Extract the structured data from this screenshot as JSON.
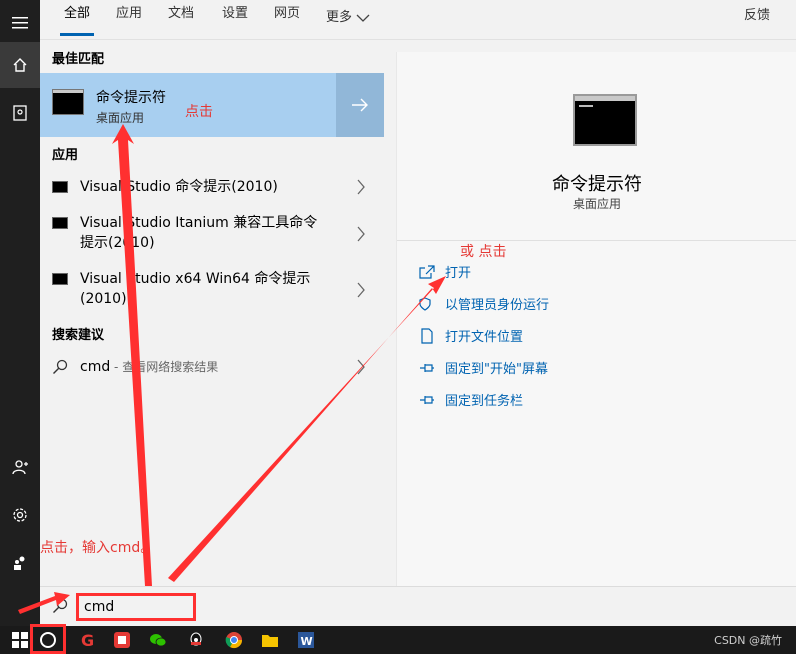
{
  "tabs": [
    {
      "label": "全部"
    },
    {
      "label": "应用"
    },
    {
      "label": "文档"
    },
    {
      "label": "设置"
    },
    {
      "label": "网页"
    },
    {
      "label": "更多"
    }
  ],
  "feedback_label": "反馈",
  "sections": {
    "best_match": "最佳匹配",
    "apps": "应用",
    "suggestions": "搜索建议"
  },
  "best_match": {
    "title": "命令提示符",
    "subtitle": "桌面应用"
  },
  "apps": [
    {
      "label": "Visual Studio 命令提示(2010)"
    },
    {
      "label": "Visual Studio Itanium 兼容工具命令提示(2010)"
    },
    {
      "label": "Visual Studio x64 Win64 命令提示(2010)"
    }
  ],
  "suggestion": {
    "term": "cmd",
    "hint": " - 查看网络搜索结果"
  },
  "detail": {
    "title": "命令提示符",
    "subtitle": "桌面应用"
  },
  "actions": [
    {
      "label": "打开",
      "icon": "open-icon"
    },
    {
      "label": "以管理员身份运行",
      "icon": "shield-icon"
    },
    {
      "label": "打开文件位置",
      "icon": "folder-icon"
    },
    {
      "label": "固定到\"开始\"屏幕",
      "icon": "pin-icon"
    },
    {
      "label": "固定到任务栏",
      "icon": "pin-icon"
    }
  ],
  "search": {
    "value": "cmd"
  },
  "annotations": {
    "click": "点击",
    "or_click": "或 点击",
    "click_input": "点击，输入cmd。"
  },
  "watermark": "CSDN @疏竹",
  "colors": {
    "accent": "#0063b1",
    "highlight": "#a8cff0",
    "annotation": "#e53935"
  }
}
